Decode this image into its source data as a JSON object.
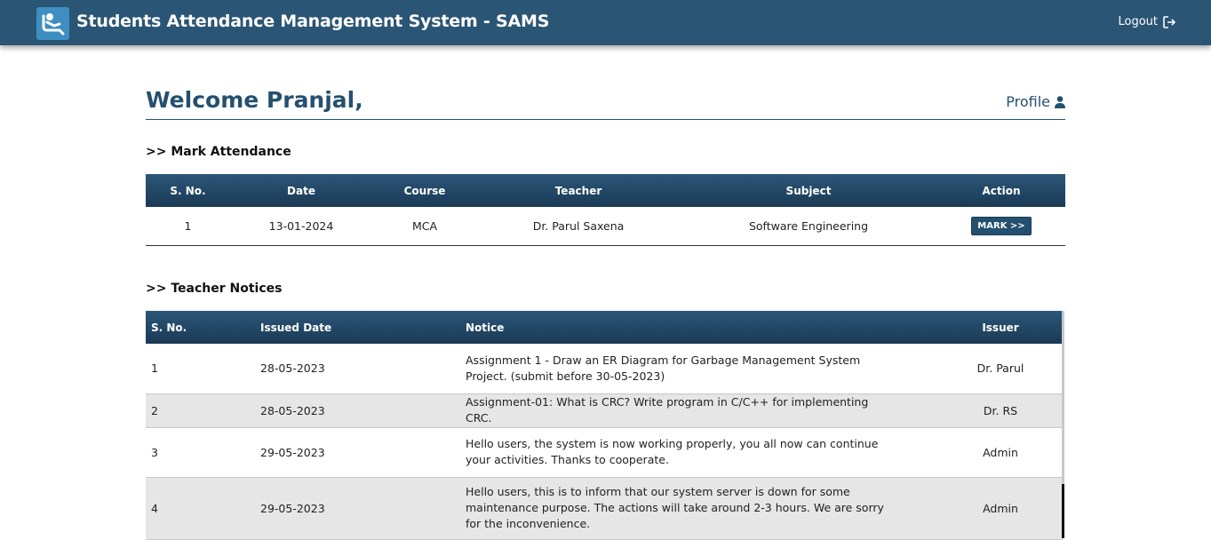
{
  "header": {
    "title": "Students Attendance Management System - SAMS",
    "logout_label": "Logout"
  },
  "welcome": {
    "text": "Welcome Pranjal,",
    "profile_label": "Profile"
  },
  "attendance": {
    "section_title": ">> Mark Attendance",
    "columns": [
      "S. No.",
      "Date",
      "Course",
      "Teacher",
      "Subject",
      "Action"
    ],
    "rows": [
      {
        "sno": "1",
        "date": "13-01-2024",
        "course": "MCA",
        "teacher": "Dr. Parul Saxena",
        "subject": "Software Engineering",
        "action": "MARK >>"
      }
    ]
  },
  "notices": {
    "section_title": ">> Teacher Notices",
    "columns": [
      "S. No.",
      "Issued Date",
      "Notice",
      "Issuer"
    ],
    "rows": [
      {
        "sno": "1",
        "date": "28-05-2023",
        "notice": "Assignment 1 - Draw an ER Diagram for Garbage Management System Project. (submit before 30-05-2023)",
        "issuer": "Dr. Parul"
      },
      {
        "sno": "2",
        "date": "28-05-2023",
        "notice": "Assignment-01: What is CRC? Write program in C/C++ for implementing CRC.",
        "issuer": "Dr. RS"
      },
      {
        "sno": "3",
        "date": "29-05-2023",
        "notice": "Hello users, the system is now working properly, you all now can continue your activities. Thanks to cooperate.",
        "issuer": "Admin"
      },
      {
        "sno": "4",
        "date": "29-05-2023",
        "notice": "Hello users, this is to inform that our system server is down for some maintenance purpose. The actions will take around 2-3 hours. We are sorry for the inconvenience.",
        "issuer": "Admin"
      }
    ]
  },
  "colors": {
    "primary": "#2b5574",
    "logo_bg": "#3d8fc2",
    "alt_row": "#e6e6e6"
  },
  "icons": {
    "logo": "student-desk-icon",
    "logout": "sign-out-icon",
    "profile": "user-icon"
  }
}
